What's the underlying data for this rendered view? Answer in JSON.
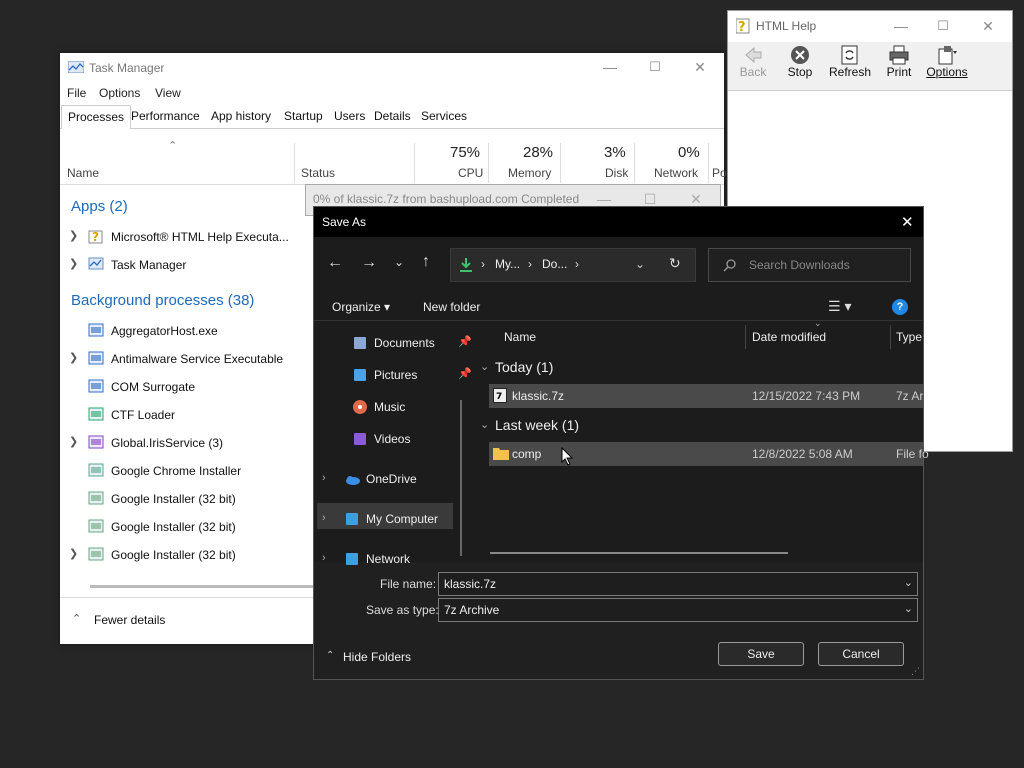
{
  "task_manager": {
    "title": "Task Manager",
    "menu": [
      "File",
      "Options",
      "View"
    ],
    "tabs": [
      "Processes",
      "Performance",
      "App history",
      "Startup",
      "Users",
      "Details",
      "Services"
    ],
    "columns": {
      "name": "Name",
      "status": "Status",
      "cpu_pct": "75%",
      "cpu": "CPU",
      "mem_pct": "28%",
      "mem": "Memory",
      "disk_pct": "3%",
      "disk": "Disk",
      "net_pct": "0%",
      "net": "Network",
      "power": "Po"
    },
    "apps_header": "Apps (2)",
    "apps": [
      {
        "name": "Microsoft® HTML Help Executa...",
        "icon": "help-icon"
      },
      {
        "name": "Task Manager",
        "icon": "task-manager-icon"
      }
    ],
    "bg_header": "Background processes (38)",
    "bg": [
      {
        "name": "AggregatorHost.exe",
        "expand": false
      },
      {
        "name": "Antimalware Service Executable",
        "expand": true
      },
      {
        "name": "COM Surrogate",
        "expand": false
      },
      {
        "name": "CTF Loader",
        "expand": false
      },
      {
        "name": "Global.IrisService (3)",
        "expand": true
      },
      {
        "name": "Google Chrome Installer",
        "expand": false
      },
      {
        "name": "Google Installer (32 bit)",
        "expand": false
      },
      {
        "name": "Google Installer (32 bit)",
        "expand": false
      },
      {
        "name": "Google Installer (32 bit)",
        "expand": true
      }
    ],
    "fewer_details": "Fewer details"
  },
  "html_help": {
    "title": "HTML Help",
    "buttons": [
      {
        "label": "Back",
        "icon": "back-arrow-icon"
      },
      {
        "label": "Stop",
        "icon": "stop-icon"
      },
      {
        "label": "Refresh",
        "icon": "refresh-icon"
      },
      {
        "label": "Print",
        "icon": "printer-icon"
      },
      {
        "label": "Options",
        "icon": "options-icon"
      }
    ]
  },
  "download": {
    "text": "0% of klassic.7z from bashupload.com Completed"
  },
  "save_as": {
    "title": "Save As",
    "breadcrumb": [
      "My...",
      "Do..."
    ],
    "search_placeholder": "Search Downloads",
    "organize": "Organize",
    "new_folder": "New folder",
    "sidebar": [
      {
        "label": "Documents",
        "icon": "documents-icon",
        "pinned": true
      },
      {
        "label": "Pictures",
        "icon": "pictures-icon",
        "pinned": true
      },
      {
        "label": "Music",
        "icon": "music-icon",
        "pinned": false
      },
      {
        "label": "Videos",
        "icon": "videos-icon",
        "pinned": false
      },
      {
        "label": "OneDrive",
        "icon": "cloud-icon",
        "pinned": false
      },
      {
        "label": "My Computer",
        "icon": "computer-icon",
        "pinned": false
      },
      {
        "label": "Network",
        "icon": "network-icon",
        "pinned": false
      }
    ],
    "columns": {
      "name": "Name",
      "date": "Date modified",
      "type": "Type"
    },
    "groups": [
      {
        "label": "Today (1)",
        "files": [
          {
            "name": "klassic.7z",
            "date": "12/15/2022 7:43 PM",
            "type": "7z Ar"
          }
        ]
      },
      {
        "label": "Last week (1)",
        "files": [
          {
            "name": "comp",
            "date": "12/8/2022 5:08 AM",
            "type": "File fo"
          }
        ]
      }
    ],
    "file_name_label": "File name:",
    "file_name": "klassic.7z",
    "type_label": "Save as type:",
    "type_value": "7z Archive",
    "hide_folders": "Hide Folders",
    "save": "Save",
    "cancel": "Cancel"
  },
  "colors": {
    "accent": "#1e6ab8",
    "dark_bg": "#1c1c1c",
    "selected_row": "#4a4a4a"
  }
}
